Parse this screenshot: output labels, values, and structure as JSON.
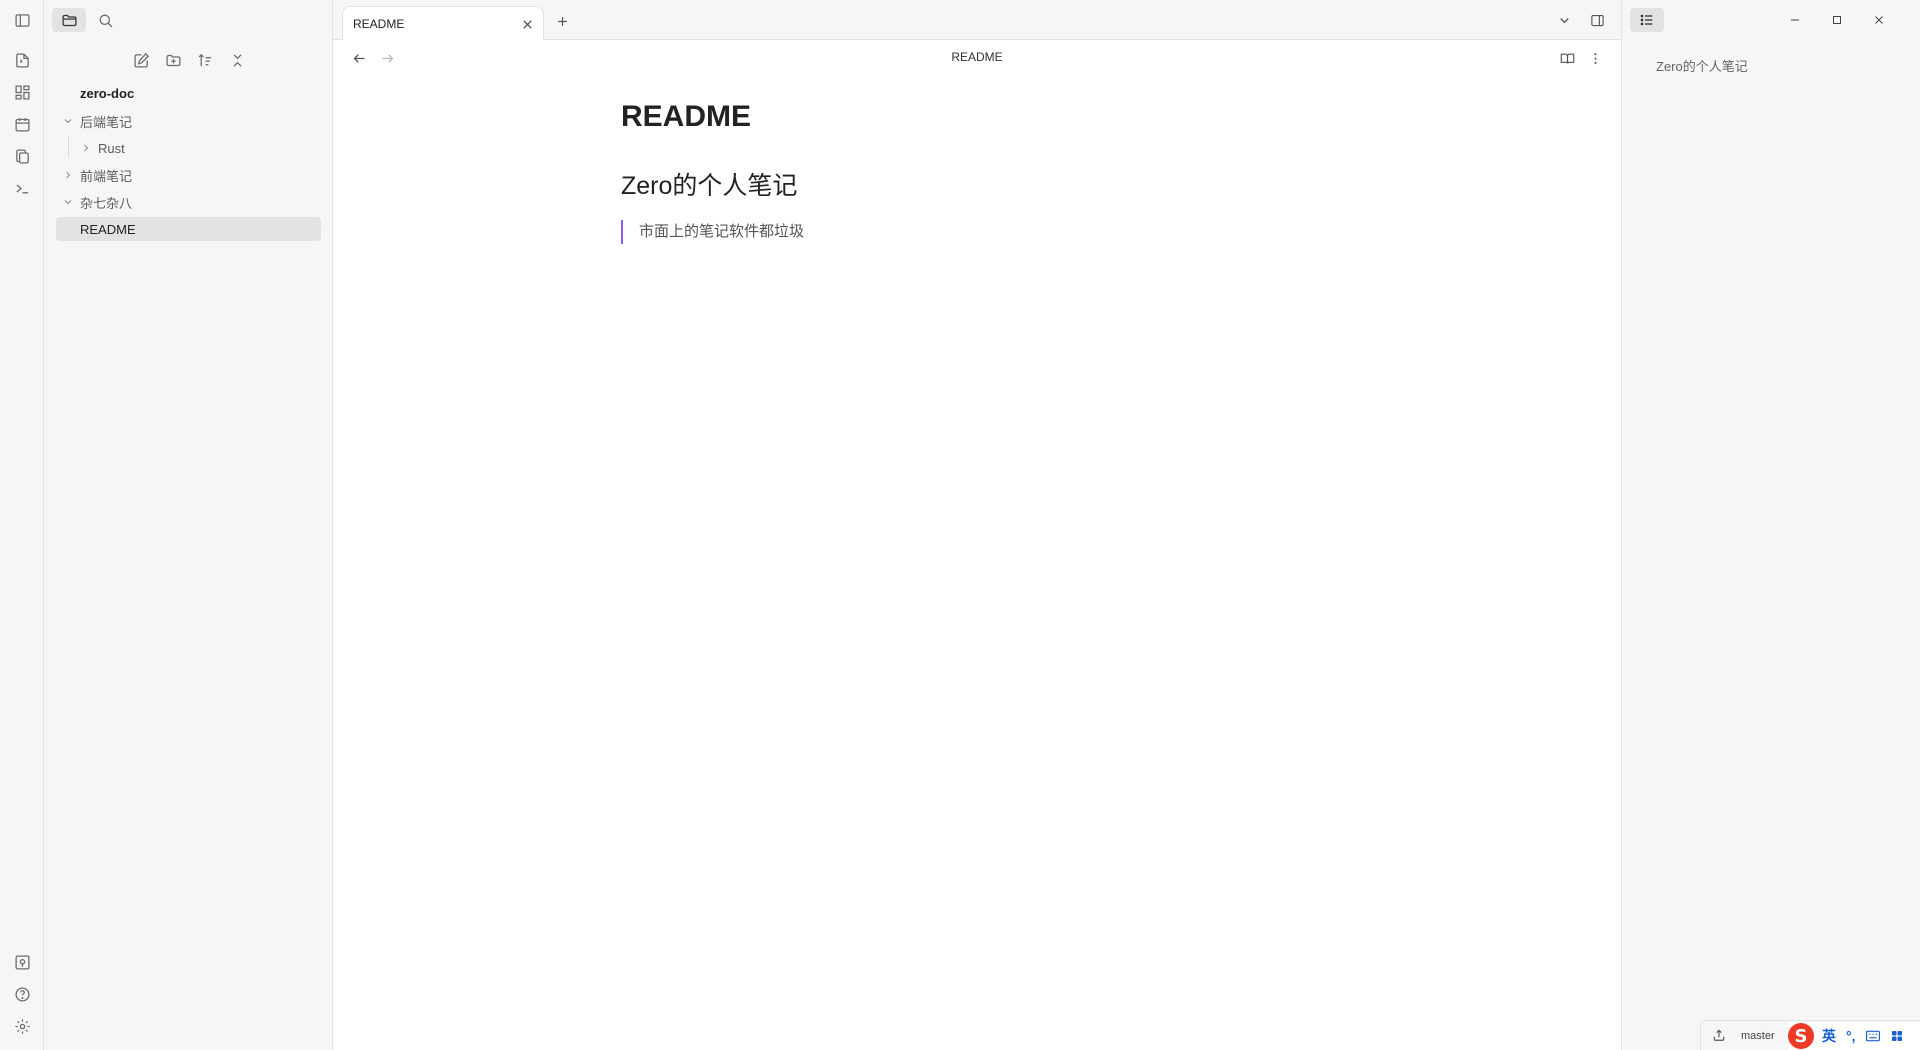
{
  "sidebar": {
    "vault_name": "zero-doc",
    "tree": [
      {
        "label": "后端笔记",
        "expanded": true
      },
      {
        "label": "Rust",
        "expanded": false
      },
      {
        "label": "前端笔记",
        "expanded": false
      },
      {
        "label": "杂七杂八",
        "expanded": true
      },
      {
        "label": "README",
        "selected": true
      }
    ]
  },
  "tabs": [
    {
      "label": "README",
      "active": true
    }
  ],
  "view": {
    "title": "README"
  },
  "document": {
    "h1": "README",
    "h2": "Zero的个人笔记",
    "quote": "市面上的笔记软件都垃圾"
  },
  "outline": {
    "items": [
      "Zero的个人笔记"
    ]
  },
  "statusbar": {
    "branch": "master"
  },
  "ime": {
    "mode": "英",
    "punct": "°,"
  },
  "colors": {
    "accent": "#8b5cf6",
    "panel_bg": "#f6f6f6",
    "border": "#e3e3e3",
    "ime_logo": "#ee3a24",
    "ime_text": "#1a5fd1"
  },
  "icons": {
    "ribbon_top": [
      "sidebar-toggle-icon"
    ],
    "ribbon": [
      "open-quick-switcher-icon",
      "canvas-icon",
      "daily-note-icon",
      "templates-icon",
      "command-palette-icon"
    ],
    "ribbon_bottom": [
      "vault-switch-icon",
      "help-icon",
      "settings-icon"
    ]
  }
}
